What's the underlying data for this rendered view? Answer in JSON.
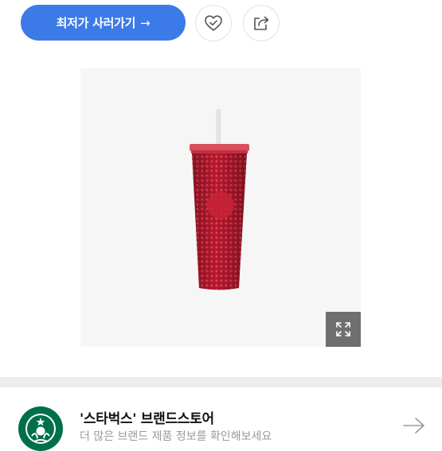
{
  "actions": {
    "buy_label": "최저가 사러가기",
    "buy_arrow": "→"
  },
  "icons": {
    "wish": "heart-check-icon",
    "share": "share-icon",
    "expand": "expand-icon",
    "next": "arrow-right-icon"
  },
  "brand": {
    "name": "'스타벅스' 브랜드스토어",
    "subtitle": "더 많은 브랜드 제품 정보를 확인해보세요"
  },
  "colors": {
    "primary": "#3c7ae8",
    "brand_green": "#00704a",
    "tumbler_red": "#b3172c"
  }
}
